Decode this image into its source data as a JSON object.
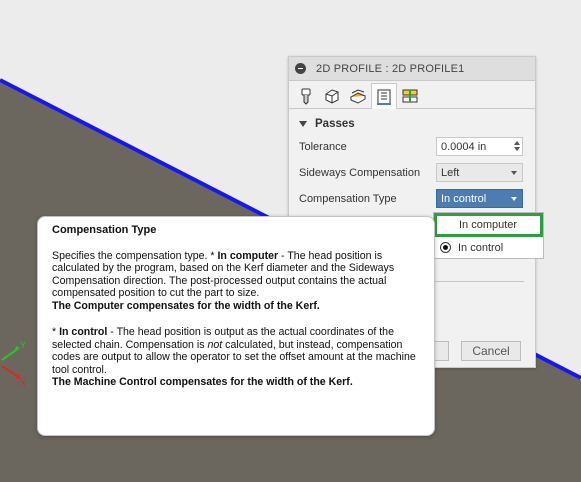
{
  "colors": {
    "background": "#ececec",
    "ground": "#6b675e",
    "edge_line": "#1818ee",
    "accent": "#4d7cb0",
    "highlight": "#2f9e41"
  },
  "dialog": {
    "title": "2D PROFILE : 2D PROFILE1",
    "tabs": [
      {
        "icon": "tool-icon"
      },
      {
        "icon": "geometry-icon"
      },
      {
        "icon": "heights-icon"
      },
      {
        "icon": "passes-icon",
        "active": true
      },
      {
        "icon": "linking-icon"
      }
    ],
    "section": "Passes",
    "tolerance": {
      "label": "Tolerance",
      "value": "0.0004 in"
    },
    "sideways": {
      "label": "Sideways Compensation",
      "value": "Left"
    },
    "comp_type": {
      "label": "Compensation Type",
      "value": "In control",
      "options": [
        "In computer",
        "In control"
      ],
      "selected": "In control",
      "hovered": "In computer"
    },
    "ok_label": "",
    "cancel_label": "Cancel"
  },
  "tooltip": {
    "title": "Compensation Type",
    "p1_a": "Specifies the compensation type. * ",
    "p1_b": "In computer",
    "p1_c": " - The head position is calculated by the program, based on the Kerf diameter and the Sideways Compensation direction. The post-processed output contains the actual compensated position to cut the part to size.",
    "p1_bold": "The Computer compensates for the width of the Kerf.",
    "p2_a": "* ",
    "p2_b": "In control",
    "p2_c": " - The head position is output as the actual coordinates of the selected chain. Compensation is ",
    "p2_em": "not",
    "p2_d": " calculated, but instead, compensation codes are output to allow the operator to set the offset amount at the machine tool control.",
    "p2_bold": "The Machine Control compensates for the width of the Kerf."
  },
  "axis_triad": {
    "y_label": "Y",
    "x_label": "X"
  }
}
